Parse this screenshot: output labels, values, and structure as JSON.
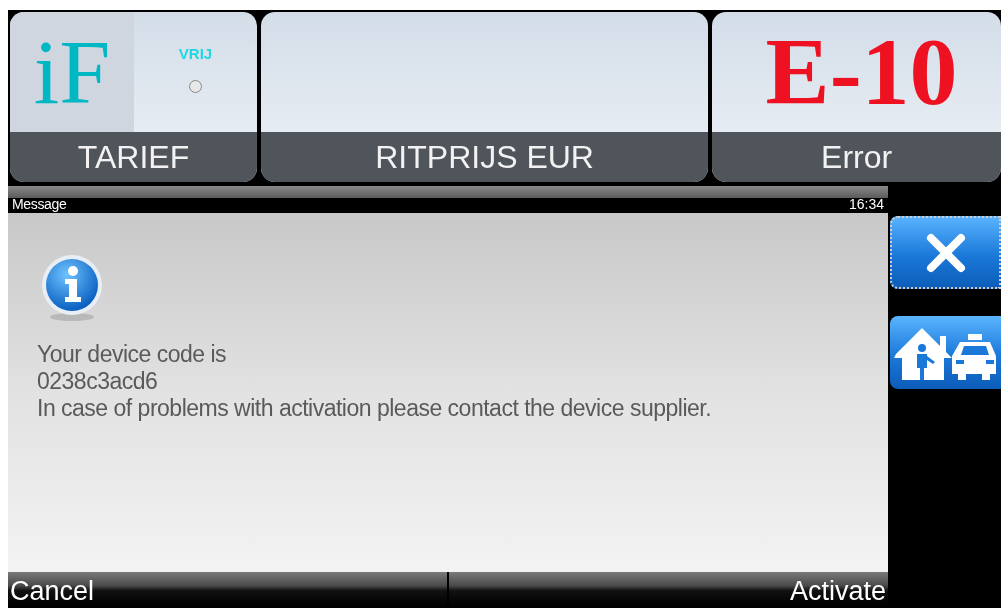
{
  "tiles": [
    {
      "kind": "tariff",
      "logo": "iF",
      "status": "VRIJ",
      "label": "TARIEF"
    },
    {
      "kind": "blank",
      "label": "RITPRIJS EUR"
    },
    {
      "kind": "error",
      "value": "E-10",
      "label": "Error"
    }
  ],
  "message_bar": {
    "title": "Message",
    "time": "16:34"
  },
  "message": {
    "lines": [
      "Your device code is",
      "0238c3acd6",
      "In case of problems with activation please contact the device supplier."
    ]
  },
  "buttons": [
    {
      "label": "Cancel",
      "kind": "cancel"
    },
    {
      "label": "Activate",
      "kind": "confirm"
    }
  ],
  "side_buttons": [
    {
      "kind": "close",
      "focused": true
    },
    {
      "kind": "home-taxi",
      "focused": false
    }
  ]
}
